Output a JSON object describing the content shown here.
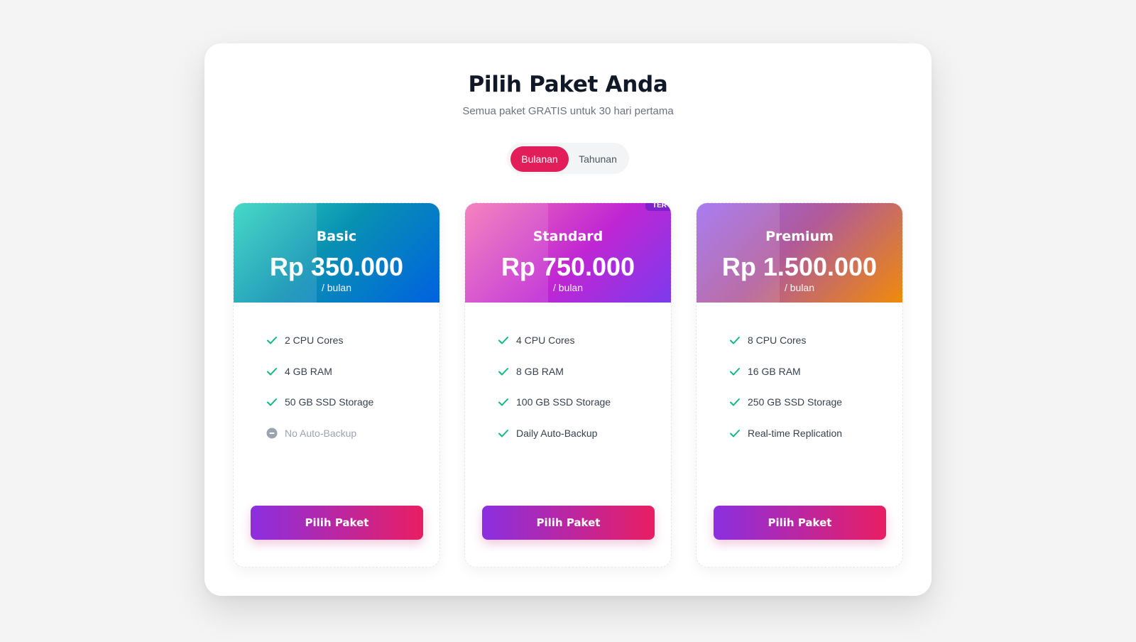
{
  "header": {
    "title": "Pilih Paket Anda",
    "subtitle": "Semua paket GRATIS untuk 30 hari pertama"
  },
  "billing_toggle": {
    "options": [
      "Bulanan",
      "Tahunan"
    ],
    "selected": "Bulanan"
  },
  "plans": [
    {
      "name": "Basic",
      "price": "Rp 350.000",
      "period": "/ bulan",
      "features": [
        {
          "label": "2 CPU Cores",
          "included": true
        },
        {
          "label": "4 GB RAM",
          "included": true
        },
        {
          "label": "50 GB SSD Storage",
          "included": true
        },
        {
          "label": "No Auto-Backup",
          "included": false
        }
      ],
      "cta": "Pilih Paket"
    },
    {
      "name": "Standard",
      "price": "Rp 750.000",
      "period": "/ bulan",
      "badge": "TER",
      "features": [
        {
          "label": "4 CPU Cores",
          "included": true
        },
        {
          "label": "8 GB RAM",
          "included": true
        },
        {
          "label": "100 GB SSD Storage",
          "included": true
        },
        {
          "label": "Daily Auto-Backup",
          "included": true
        }
      ],
      "cta": "Pilih Paket"
    },
    {
      "name": "Premium",
      "price": "Rp 1.500.000",
      "period": "/ bulan",
      "features": [
        {
          "label": "8 CPU Cores",
          "included": true
        },
        {
          "label": "16 GB RAM",
          "included": true
        },
        {
          "label": "250 GB SSD Storage",
          "included": true
        },
        {
          "label": "Real-time Replication",
          "included": true
        }
      ],
      "cta": "Pilih Paket"
    }
  ],
  "colors": {
    "accent": "#e11d5a",
    "check": "#10b981",
    "disabled": "#9ca3af"
  }
}
